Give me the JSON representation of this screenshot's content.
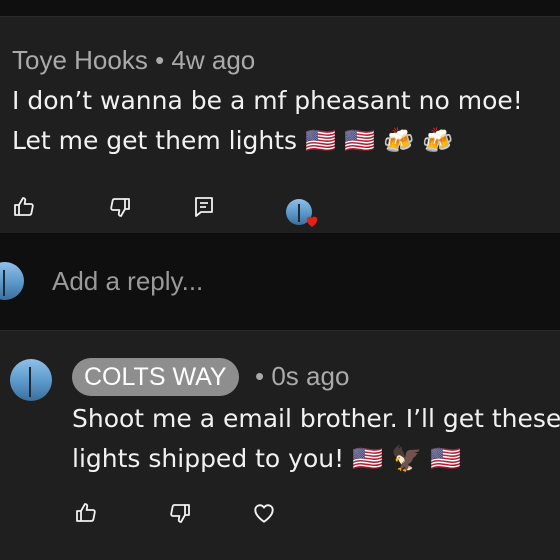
{
  "comment": {
    "author": "Toye Hooks",
    "separator": "•",
    "time": "4w ago",
    "text": "I don’t wanna be a mf pheasant no moe! Let me get them lights 🇺🇸 🇺🇸 🍻 🍻"
  },
  "reply_box": {
    "placeholder": "Add a reply..."
  },
  "reply": {
    "author": "COLTS WAY",
    "separator": "•",
    "time": "0s ago",
    "text": "Shoot me a email brother. I’ll get these lights shipped to you! 🇺🇸 🦅 🇺🇸"
  },
  "icons": {
    "like": "thumbs-up-icon",
    "dislike": "thumbs-down-icon",
    "reply": "comment-icon",
    "heart_badge": "creator-heart-icon",
    "heart": "heart-icon"
  },
  "colors": {
    "background": "#0f0f0f",
    "card": "#1f1f1f",
    "meta_text": "#aaaaaa",
    "chip": "#8e8e8e",
    "heart_red": "#e62117"
  }
}
